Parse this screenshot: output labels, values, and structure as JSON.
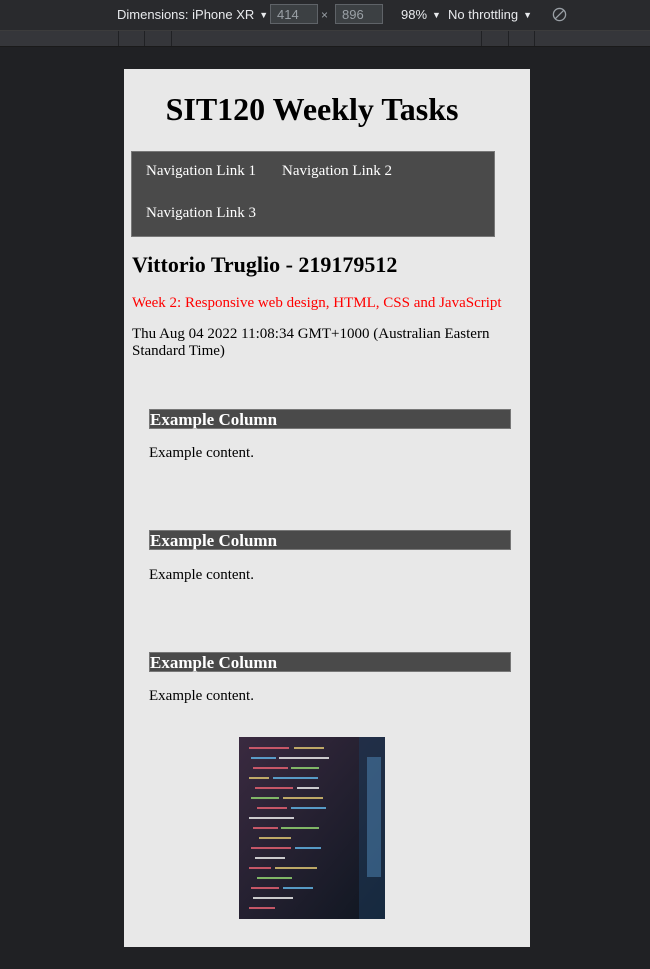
{
  "devtools": {
    "device_label": "Dimensions: iPhone XR",
    "width_value": "414",
    "height_value": "896",
    "zoom_label": "98%",
    "throttle_label": "No throttling"
  },
  "page": {
    "title": "SIT120 Weekly Tasks",
    "nav": [
      "Navigation Link 1",
      "Navigation Link 2",
      "Navigation Link 3"
    ],
    "author": "Vittorio Truglio - 219179512",
    "week": "Week 2: Responsive web design, HTML, CSS and JavaScript",
    "datetime": "Thu Aug 04 2022 11:08:34 GMT+1000 (Australian Eastern Standard Time)",
    "columns": [
      {
        "heading": "Example Column",
        "content": "Example content."
      },
      {
        "heading": "Example Column",
        "content": "Example content."
      },
      {
        "heading": "Example Column",
        "content": "Example content."
      }
    ]
  },
  "colors": {
    "page_bg": "#e8e8e8",
    "nav_bg": "#4a4a4a",
    "week_text": "#ff0000",
    "devtools_bg": "#202124"
  }
}
